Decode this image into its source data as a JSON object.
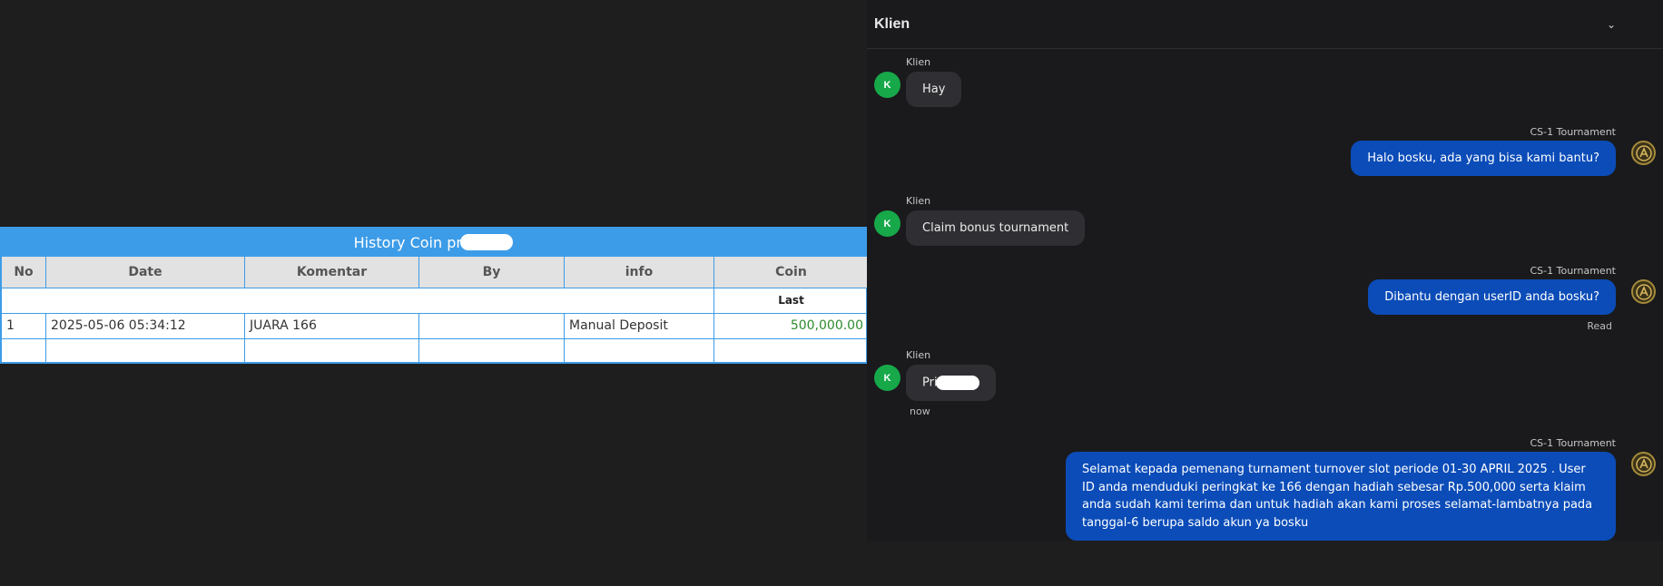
{
  "history": {
    "title": "History Coin pri",
    "columns": [
      "No",
      "Date",
      "Komentar",
      "By",
      "info",
      "Coin"
    ],
    "subheader_last": "Last",
    "rows": [
      {
        "no": "1",
        "date": "2025-05-06 05:34:12",
        "komentar": "JUARA 166",
        "by": "",
        "info": "Manual Deposit",
        "coin": "500,000.00"
      }
    ]
  },
  "chat": {
    "header_title": "Klien",
    "header_chevron": "⌄",
    "messages": [
      {
        "sender": "Klien",
        "avatar": "K",
        "text": "Hay"
      },
      {
        "sender": "CS-1 Tournament",
        "text": "Halo bosku, ada yang bisa kami bantu?"
      },
      {
        "sender": "Klien",
        "avatar": "K",
        "text": "Claim bonus tournament"
      },
      {
        "sender": "CS-1 Tournament",
        "text": "Dibantu dengan userID anda bosku?",
        "status": "Read"
      },
      {
        "sender": "Klien",
        "avatar": "K",
        "text": "Pri",
        "time": "now"
      },
      {
        "sender": "CS-1 Tournament",
        "text": "Selamat kepada pemenang turnament turnover slot periode 01-30 APRIL 2025 . User ID anda menduduki peringkat ke 166 dengan hadiah sebesar Rp.500,000 serta klaim anda sudah kami terima dan untuk hadiah akan kami proses selamat-lambatnya pada tanggal-6 berupa saldo akun ya bosku"
      }
    ],
    "agent_avatar_icon": "gold-emblem-icon",
    "colors": {
      "agent_bubble": "#0b4cb8",
      "client_bubble": "#2f2f33",
      "client_avatar": "#17a84a",
      "coin_green": "#2e8b2e",
      "table_accent": "#3d9ce8"
    }
  }
}
